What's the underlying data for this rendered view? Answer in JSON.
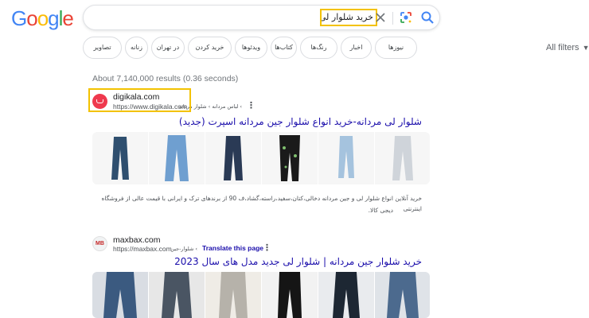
{
  "logo": {
    "letters": [
      "G",
      "o",
      "o",
      "g",
      "l",
      "e"
    ],
    "colors": [
      "#4285f4",
      "#ea4335",
      "#fbbc05",
      "#4285f4",
      "#34a853",
      "#ea4335"
    ]
  },
  "search": {
    "query": "خرید شلوار لی",
    "clear_icon": "close-icon",
    "lens_icon": "google-lens-icon",
    "submit_icon": "search-icon"
  },
  "chips": [
    "نیوزها",
    "اخبار",
    "رنگ‌ها",
    "کتاب‌ها",
    "ویدئوها",
    "خرید کردن",
    "در تهران",
    "زنانه",
    "تصاویر"
  ],
  "all_filters": "All filters",
  "results_stats": "About 7,140,000 results (0.36 seconds)",
  "results": [
    {
      "site_name": "digikala.com",
      "url": "https://www.digikala.com",
      "breadcrumb": "› لباس مردانه › شلوار مردانه",
      "title": "شلوار لی مردانه-خرید انواع شلوار جین مردانه اسپرت (جدید)",
      "snippet_line1": "خرید آنلاین انواع شلوار لی و جین مردانه دخالی،کتان،سفید،راسته،گشاد،ف 90 از برندهای ترک و ایرانی با قیمت عالی از فروشگاه اینترنتی",
      "snippet_line2": "دیجی کالا.",
      "thumbs": [
        "#2f4f6f",
        "#6f9fd0",
        "#2a3a55",
        "#1a1a1a",
        "#a5c3de",
        "#cfd4da"
      ]
    },
    {
      "site_name": "maxbax.com",
      "url": "https://maxbax.com",
      "breadcrumb": "› شلوار-جین",
      "translate": "Translate this page",
      "title": "خرید شلوار جین مردانه | شلوار لی جدید مدل های سال 2023",
      "thumbs": [
        "#3b5a80",
        "#4a5563",
        "#b6b2aa",
        "#151515",
        "#1d2733",
        "#4c6a8e"
      ]
    }
  ]
}
